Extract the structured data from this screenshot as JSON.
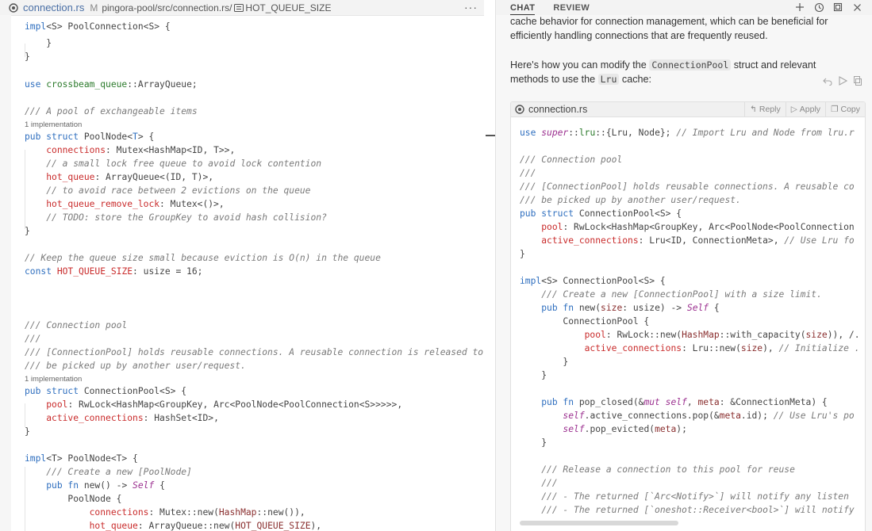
{
  "editor": {
    "tab": {
      "filename": "connection.rs",
      "modified": "M",
      "path": "pingora-pool/src/connection.rs/",
      "symbol": "HOT_QUEUE_SIZE",
      "more": "···"
    },
    "hints": {
      "impl1": "1 implementation",
      "impl2": "1 implementation"
    }
  },
  "chat": {
    "tabs": [
      "CHAT",
      "REVIEW"
    ],
    "text1_line1": "cache behavior for connection management, which can be beneficial for",
    "text1_line2": "efficiently handling connections that are frequently reused.",
    "text2_a": "Here's how you can modify the ",
    "text2_code1": "ConnectionPool",
    "text2_b": " struct and relevant",
    "text2_c": "methods to use the ",
    "text2_code2": "Lru",
    "text2_d": " cache:",
    "codeblock": {
      "filename": "connection.rs",
      "reply": "Reply",
      "apply": "Apply",
      "copy": "Copy"
    }
  },
  "colors": {
    "keyword": "#2f6fbf",
    "field": "#c92b2b",
    "comment": "#7a7a7a",
    "accent": "#4a6fa5"
  },
  "icons": [
    "rust-icon",
    "symbol-icon",
    "more-icon",
    "plus-icon",
    "history-icon",
    "maximize-icon",
    "close-icon",
    "undo-icon",
    "play-icon",
    "copy-icon",
    "reply-icon",
    "apply-icon"
  ]
}
